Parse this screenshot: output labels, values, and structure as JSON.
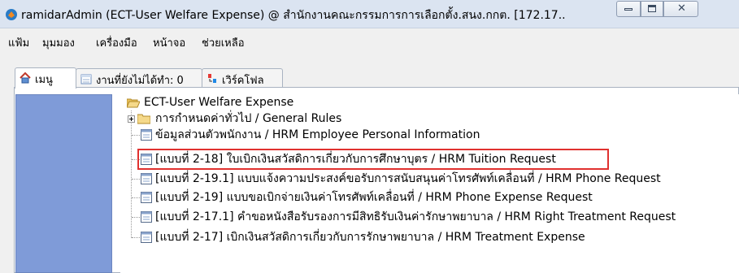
{
  "window": {
    "title": "ramidarAdmin (ECT-User Welfare Expense) @ สำนักงานคณะกรรมการการเลือกตั้ง.สนง.กกต. [172.17.."
  },
  "menubar": {
    "items": [
      {
        "key": "file",
        "label": "แฟ้ม"
      },
      {
        "key": "view",
        "label": "มุมมอง"
      },
      {
        "key": "tools",
        "label": "เครื่องมือ"
      },
      {
        "key": "window",
        "label": "หน้าจอ"
      },
      {
        "key": "help",
        "label": "ช่วยเหลือ"
      }
    ]
  },
  "tabs": [
    {
      "label": "เมนู",
      "icon": "home-icon",
      "active": true
    },
    {
      "label": "งานที่ยังไม่ได้ทำ: 0",
      "icon": "calendar-icon",
      "active": false
    },
    {
      "label": "เวิร์คโฟล",
      "icon": "workflow-icon",
      "active": false
    }
  ],
  "tree": {
    "root": {
      "label": "ECT-User Welfare Expense",
      "icon": "folder-open-icon"
    },
    "items": [
      {
        "label": "การกำหนดค่าทั่วไป / General Rules",
        "icon": "folder-icon",
        "expandable": true
      },
      {
        "label": "ข้อมูลส่วนตัวพนักงาน / HRM Employee Personal Information",
        "icon": "document-icon"
      },
      {
        "label": "[แบบที่ 2-18] ใบเบิกเงินสวัสดิการเกี่ยวกับการศึกษาบุตร / HRM Tuition Request",
        "icon": "document-icon",
        "highlighted": true
      },
      {
        "label": "[แบบที่ 2-19.1] แบบแจ้งความประสงค์ขอรับการสนับสนุนค่าโทรศัพท์เคลื่อนที่ / HRM Phone Request",
        "icon": "document-icon"
      },
      {
        "label": "[แบบที่ 2-19] แบบขอเบิกจ่ายเงินค่าโทรศัพท์เคลื่อนที่ / HRM Phone Expense Request",
        "icon": "document-icon"
      },
      {
        "label": "[แบบที่ 2-17.1] คำขอหนังสือรับรองการมีสิทธิรับเงินค่ารักษาพยาบาล / HRM Right Treatment Request",
        "icon": "document-icon"
      },
      {
        "label": "[แบบที่ 2-17] เบิกเงินสวัสดิการเกี่ยวกับการรักษาพยาบาล / HRM Treatment Expense",
        "icon": "document-icon"
      }
    ]
  },
  "colors": {
    "side_panel": "#7f9bd8",
    "highlight_border": "#e0312f",
    "titlebar": "#dbe4f1"
  }
}
